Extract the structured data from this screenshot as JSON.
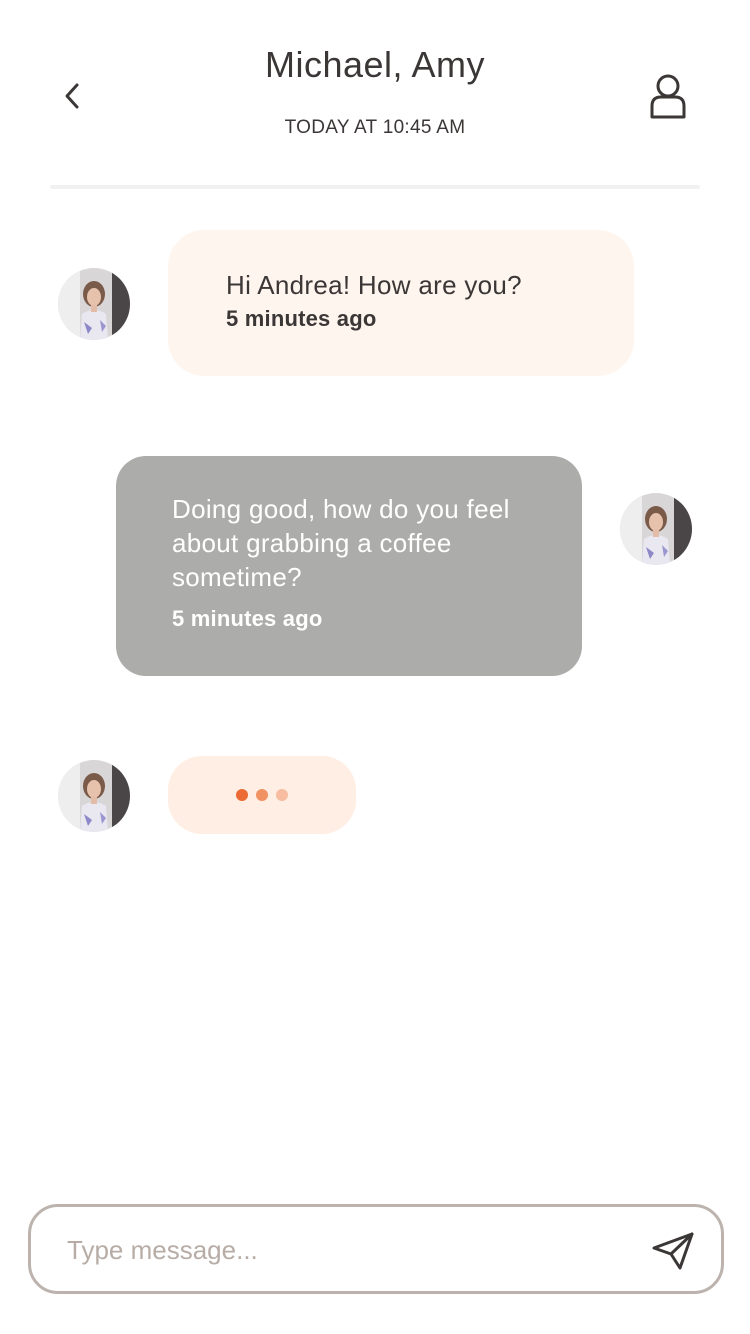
{
  "header": {
    "title": "Michael, Amy",
    "subtitle": "TODAY AT 10:45 AM",
    "back_icon": "chevron-left-icon",
    "profile_icon": "user-icon"
  },
  "messages": [
    {
      "direction": "incoming",
      "text": "Hi Andrea! How are you?",
      "time": "5 minutes ago"
    },
    {
      "direction": "outgoing",
      "text": "Doing good, how do you feel about grabbing a coffee sometime?",
      "time": "5 minutes ago"
    }
  ],
  "typing_indicator": {
    "dot_colors": [
      "#ec6a33",
      "#f19262",
      "#f8bca0"
    ]
  },
  "composer": {
    "placeholder": "Type message...",
    "value": "",
    "send_icon": "send-icon"
  },
  "colors": {
    "incoming_bubble": "#fff5ef",
    "outgoing_bubble": "#acacab",
    "typing_bubble": "#ffeee3",
    "text_dark": "#3b3736",
    "input_border": "#bcb3ae"
  }
}
